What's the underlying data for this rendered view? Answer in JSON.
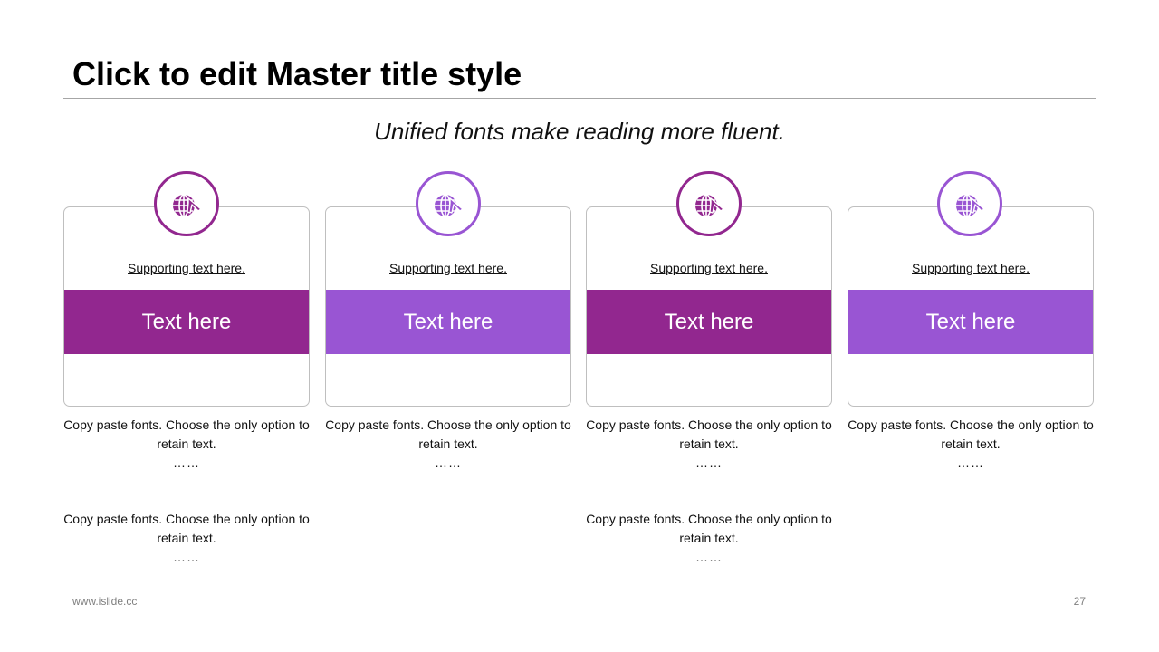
{
  "slide": {
    "title": "Click to edit Master title style",
    "subtitle": "Unified fonts make reading more fluent.",
    "footer_url": "www.islide.cc",
    "page_number": "27"
  },
  "colors": {
    "dark_purple": "#92278f",
    "light_purple": "#9955d3"
  },
  "cards": [
    {
      "icon": "globe-plane-icon",
      "support": "Supporting text here.",
      "label": "Text here",
      "color": "#92278f"
    },
    {
      "icon": "globe-plane-icon",
      "support": "Supporting text here.",
      "label": "Text here",
      "color": "#9955d3"
    },
    {
      "icon": "globe-plane-icon",
      "support": "Supporting text here.",
      "label": "Text here",
      "color": "#92278f"
    },
    {
      "icon": "globe-plane-icon",
      "support": "Supporting text here.",
      "label": "Text here",
      "color": "#9955d3"
    }
  ],
  "descriptions": {
    "row1": [
      {
        "text": "Copy paste fonts. Choose the only option to retain text.",
        "dots": "……"
      },
      {
        "text": "Copy paste fonts. Choose the only option to retain text.",
        "dots": "……"
      },
      {
        "text": "Copy paste fonts. Choose the only option to retain text.",
        "dots": "……"
      },
      {
        "text": "Copy paste fonts. Choose the only option to retain text.",
        "dots": "……"
      }
    ],
    "row2": [
      {
        "text": "Copy paste fonts. Choose the only option to retain text.",
        "dots": "……"
      },
      {
        "text": "Copy paste fonts. Choose the only option to retain text.",
        "dots": "……"
      }
    ]
  }
}
